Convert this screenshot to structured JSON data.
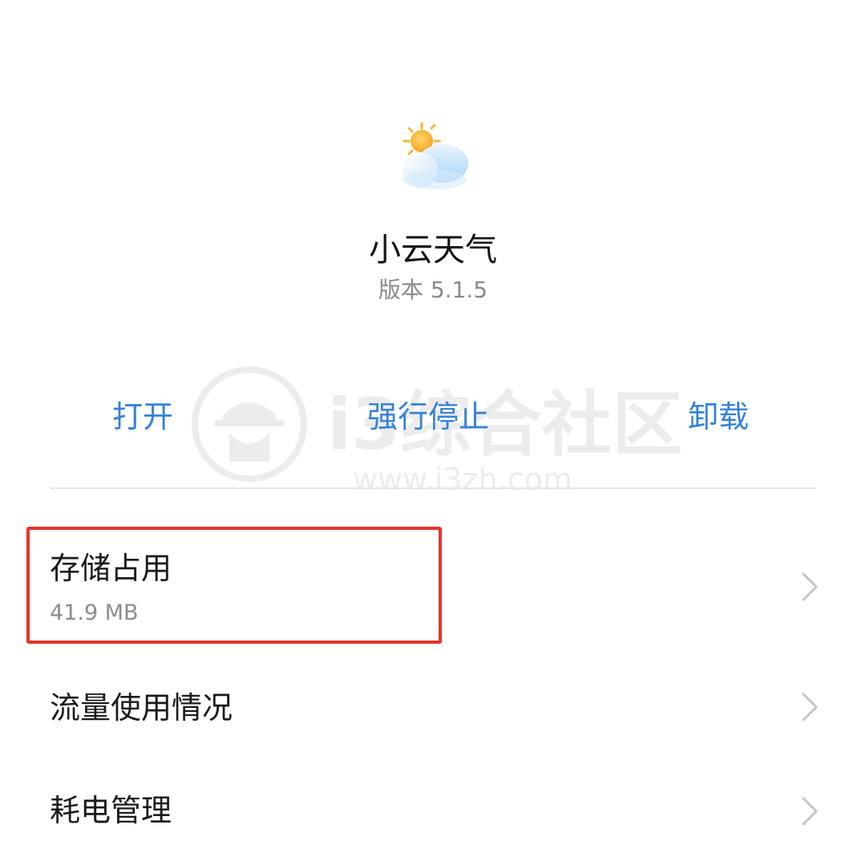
{
  "app": {
    "name": "小云天气",
    "version": "版本 5.1.5",
    "icon": "weather-sun-cloud-icon"
  },
  "actions": {
    "open_label": "打开",
    "force_stop_label": "强行停止",
    "uninstall_label": "卸载"
  },
  "settings": {
    "storage": {
      "title": "存储占用",
      "value": "41.9 MB"
    },
    "data_usage": {
      "title": "流量使用情况"
    },
    "battery": {
      "title": "耗电管理"
    }
  },
  "watermark": {
    "text": "i3综合社区",
    "url": "www.i3zh.com"
  },
  "colors": {
    "accent": "#3582d8",
    "highlight": "#e8322b",
    "divider": "#e6e6e6",
    "secondary_text": "#8a8a8a"
  }
}
